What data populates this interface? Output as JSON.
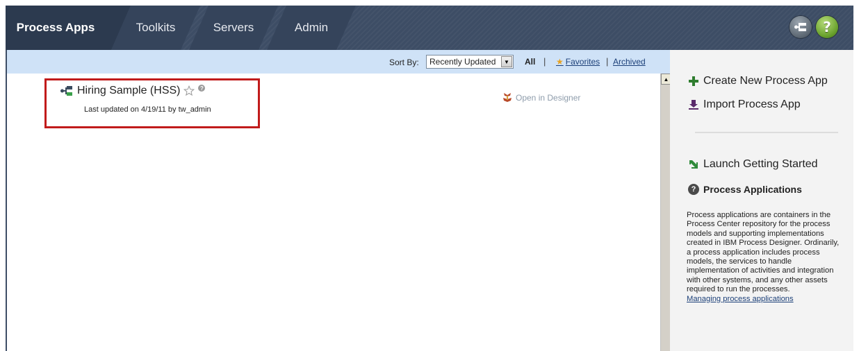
{
  "tabs": [
    {
      "label": "Process Apps",
      "active": true
    },
    {
      "label": "Toolkits",
      "active": false
    },
    {
      "label": "Servers",
      "active": false
    },
    {
      "label": "Admin",
      "active": false
    }
  ],
  "header_icons": {
    "process_app": "process-app-icon",
    "help": "?"
  },
  "sortbar": {
    "sort_label": "Sort By:",
    "sort_value": "Recently Updated",
    "filter_all": "All",
    "separator": "|",
    "filter_favorites": "Favorites",
    "filter_archived": "Archived"
  },
  "apps": [
    {
      "name": "Hiring Sample (HSS)",
      "last_updated": "Last updated on 4/19/11 by tw_admin",
      "open_label": "Open in Designer"
    }
  ],
  "sidebar": {
    "create_label": "Create New Process App",
    "import_label": "Import Process App",
    "launch_label": "Launch Getting Started",
    "heading": "Process Applications",
    "description": "Process applications are containers in the Process Center repository for the process models and supporting implementations created in IBM Process Designer. Ordinarily, a process application includes process models, the services to handle implementation of activities and integration with other systems, and any other assets required to run the processes.",
    "help_link": "Managing process applications"
  },
  "colors": {
    "topbar": "#3d4d65",
    "active_tab": "#2c3a4f",
    "sortbar": "#cfe2f7",
    "highlight_box": "#c11b1b",
    "link": "#1b3f78",
    "sidebar": "#f3f3f3"
  }
}
